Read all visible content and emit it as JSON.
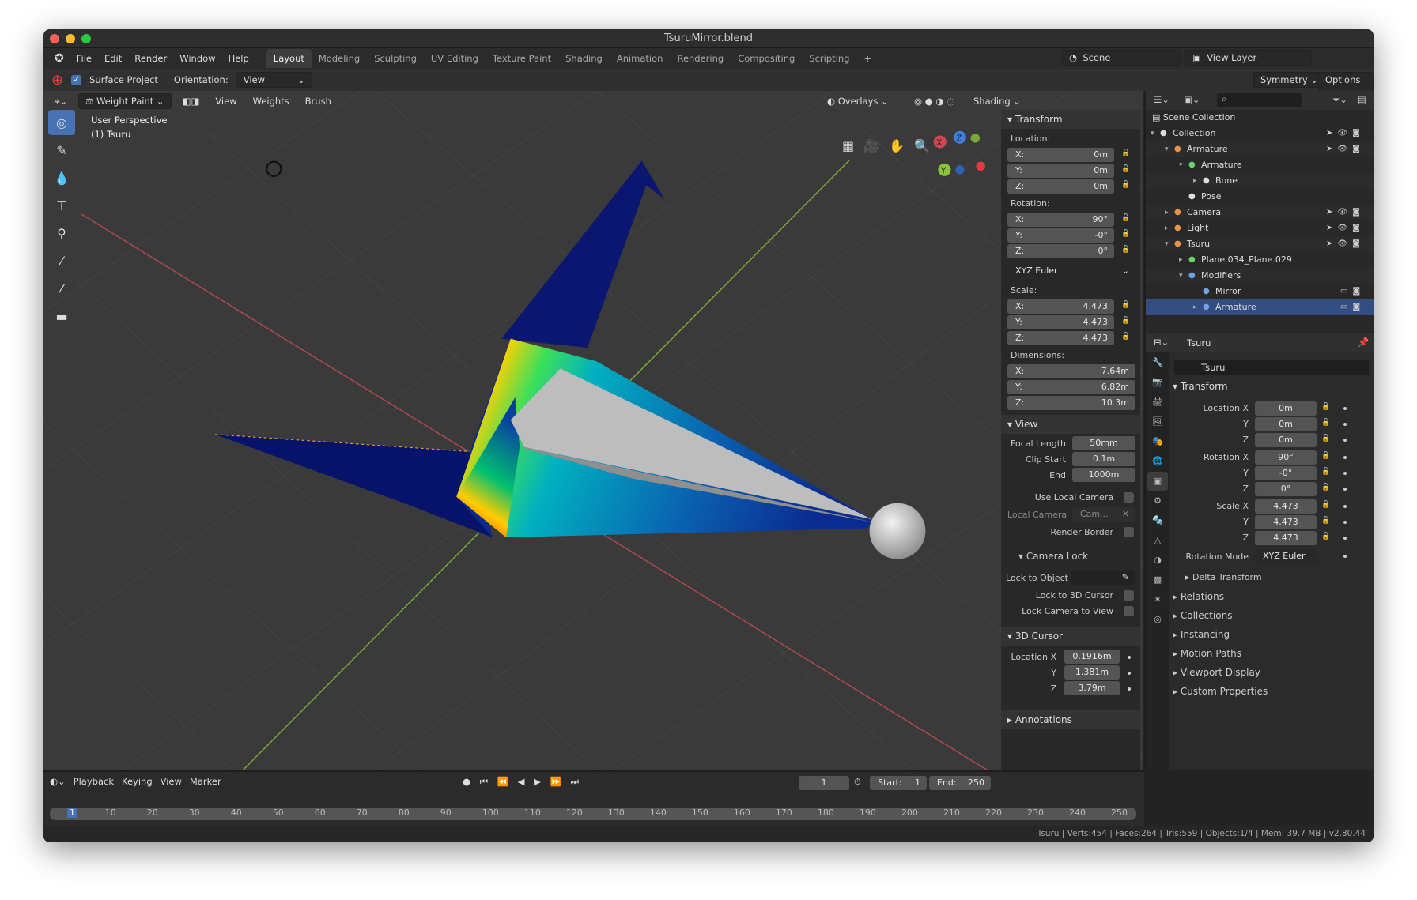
{
  "window": {
    "title": "TsuruMirror.blend"
  },
  "menu": [
    "File",
    "Edit",
    "Render",
    "Window",
    "Help"
  ],
  "workspaces": [
    "Layout",
    "Modeling",
    "Sculpting",
    "UV Editing",
    "Texture Paint",
    "Shading",
    "Animation",
    "Rendering",
    "Compositing",
    "Scripting",
    "+"
  ],
  "active_workspace": "Layout",
  "scene": {
    "name": "Scene",
    "view_layer": "View Layer"
  },
  "toolsettings": {
    "surface_project": "Surface Project",
    "orientation_label": "Orientation:",
    "orientation": "View",
    "symmetry": "Symmetry",
    "options": "Options"
  },
  "viewport": {
    "mode": "Weight Paint",
    "menus": [
      "View",
      "Weights",
      "Brush"
    ],
    "overlays": "Overlays",
    "shading": "Shading",
    "info_line1": "User Perspective",
    "info_line2": "(1) Tsuru",
    "gizmo": {
      "x": "X",
      "y": "Y",
      "z": "Z"
    }
  },
  "tools": [
    "draw-icon",
    "brush-icon",
    "blur-icon",
    "average-icon",
    "smear-icon",
    "sample-weight-icon",
    "sample-group-icon",
    "gradient-icon"
  ],
  "npanel": {
    "transform": "Transform",
    "location": "Location:",
    "loc": [
      "0m",
      "0m",
      "0m"
    ],
    "rotation": "Rotation:",
    "rot": [
      "90°",
      "-0°",
      "0°"
    ],
    "rot_mode": "XYZ Euler",
    "scale": "Scale:",
    "scl": [
      "4.473",
      "4.473",
      "4.473"
    ],
    "dimensions": "Dimensions:",
    "dim": [
      "7.64m",
      "6.82m",
      "10.3m"
    ],
    "axes": [
      "X:",
      "Y:",
      "Z:"
    ],
    "view": "View",
    "focal_label": "Focal Length",
    "focal": "50mm",
    "clip_start_label": "Clip Start",
    "clip_start": "0.1m",
    "end_label": "End",
    "end": "1000m",
    "use_local_camera": "Use Local Camera",
    "local_camera": "Local Camera",
    "local_camera_value": "Cam...",
    "render_border": "Render Border",
    "camera_lock": "Camera Lock",
    "lock_to_object": "Lock to Object",
    "lock_to_cursor": "Lock to 3D Cursor",
    "lock_cam_to_view": "Lock Camera to View",
    "cursor": "3D Cursor",
    "cursor_loc_label": "Location X",
    "cy": "Y",
    "cz": "Z",
    "cursor_loc": [
      "0.1916m",
      "1.381m",
      "3.79m"
    ],
    "annotations": "Annotations"
  },
  "outliner": {
    "root": "Scene Collection",
    "rows": [
      {
        "label": "Collection",
        "indent": 0,
        "icon": "collection-icon",
        "color": "#ddd"
      },
      {
        "label": "Armature",
        "indent": 1,
        "icon": "armature-object-icon",
        "color": "#e8954a"
      },
      {
        "label": "Armature",
        "indent": 2,
        "icon": "armature-data-icon",
        "color": "#6bd36b"
      },
      {
        "label": "Bone",
        "indent": 3,
        "icon": "bone-icon",
        "color": "#ddd"
      },
      {
        "label": "Pose",
        "indent": 2,
        "icon": "pose-icon",
        "color": "#ddd"
      },
      {
        "label": "Camera",
        "indent": 1,
        "icon": "camera-icon",
        "color": "#e8954a"
      },
      {
        "label": "Light",
        "indent": 1,
        "icon": "light-icon",
        "color": "#e8954a"
      },
      {
        "label": "Tsuru",
        "indent": 1,
        "icon": "mesh-object-icon",
        "color": "#e8954a"
      },
      {
        "label": "Plane.034_Plane.029",
        "indent": 2,
        "icon": "mesh-data-icon",
        "color": "#6bd36b"
      },
      {
        "label": "Modifiers",
        "indent": 2,
        "icon": "wrench-icon",
        "color": "#6fa2e8"
      },
      {
        "label": "Mirror",
        "indent": 3,
        "icon": "mirror-modifier-icon",
        "color": "#6fa2e8"
      },
      {
        "label": "Armature",
        "indent": 3,
        "icon": "armature-modifier-icon",
        "color": "#6fa2e8"
      }
    ]
  },
  "properties": {
    "object": "Tsuru",
    "name": "Tsuru",
    "transform": "Transform",
    "loc_label": "Location X",
    "rot_label": "Rotation X",
    "scale_label": "Scale X",
    "y": "Y",
    "z": "Z",
    "loc": [
      "0m",
      "0m",
      "0m"
    ],
    "rot": [
      "90°",
      "-0°",
      "0°"
    ],
    "scl": [
      "4.473",
      "4.473",
      "4.473"
    ],
    "rot_mode_label": "Rotation Mode",
    "rot_mode": "XYZ Euler",
    "delta": "Delta Transform",
    "panels": [
      "Relations",
      "Collections",
      "Instancing",
      "Motion Paths",
      "Viewport Display",
      "Custom Properties"
    ],
    "tabs": [
      "tool-icon",
      "render-icon",
      "output-icon",
      "view-layer-icon",
      "scene-icon",
      "world-icon",
      "object-icon",
      "constraints-icon",
      "modifier-icon",
      "mesh-data-icon",
      "material-icon",
      "texture-icon",
      "particles-icon",
      "physics-icon"
    ]
  },
  "timeline": {
    "menus": [
      "Playback",
      "Keying",
      "View",
      "Marker"
    ],
    "current": "1",
    "start_label": "Start:",
    "start": "1",
    "end_label": "End:",
    "end": "250",
    "ticks": [
      "1",
      "10",
      "20",
      "30",
      "40",
      "50",
      "60",
      "70",
      "80",
      "90",
      "100",
      "110",
      "120",
      "130",
      "140",
      "150",
      "160",
      "170",
      "180",
      "190",
      "200",
      "210",
      "220",
      "230",
      "240",
      "250"
    ]
  },
  "status": "Tsuru | Verts:454 | Faces:264 | Tris:559 | Objects:1/4 | Mem: 39.7 MB | v2.80.44",
  "colors": {
    "accent": "#4772b3",
    "x_axis": "#d0474f",
    "y_axis": "#8ac43f",
    "z_axis": "#3e7fe0"
  }
}
